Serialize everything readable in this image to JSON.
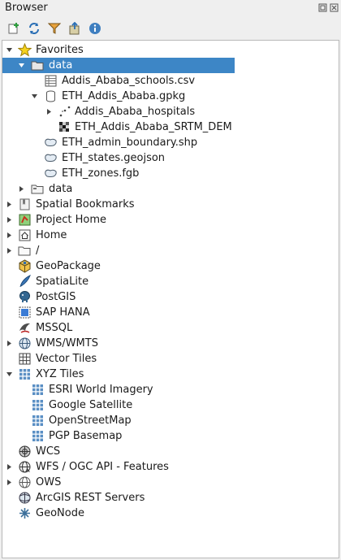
{
  "panel": {
    "title": "Browser"
  },
  "toolbar": [
    {
      "name": "add-layer-button",
      "icon": "add-layer-icon"
    },
    {
      "name": "refresh-button",
      "icon": "refresh-icon"
    },
    {
      "name": "filter-button",
      "icon": "filter-icon"
    },
    {
      "name": "collapse-all-button",
      "icon": "collapse-icon"
    },
    {
      "name": "properties-button",
      "icon": "info-icon"
    }
  ],
  "tree": {
    "favorites": "Favorites",
    "data_fav": "data",
    "schools": "Addis_Ababa_schools.csv",
    "gpkg": "ETH_Addis_Ababa.gpkg",
    "hospitals": "Addis_Ababa_hospitals",
    "dem": "ETH_Addis_Ababa_SRTM_DEM",
    "admin": "ETH_admin_boundary.shp",
    "states": "ETH_states.geojson",
    "zones": "ETH_zones.fgb",
    "data_dir": "data",
    "bookmarks": "Spatial Bookmarks",
    "project_home": "Project Home",
    "home": "Home",
    "root": "/",
    "geopackage": "GeoPackage",
    "spatialite": "SpatiaLite",
    "postgis": "PostGIS",
    "saphana": "SAP HANA",
    "mssql": "MSSQL",
    "wms": "WMS/WMTS",
    "vectortiles": "Vector Tiles",
    "xyz": "XYZ Tiles",
    "esri": "ESRI World Imagery",
    "google": "Google Satellite",
    "osm": "OpenStreetMap",
    "pgp": "PGP Basemap",
    "wcs": "WCS",
    "wfs": "WFS / OGC API - Features",
    "ows": "OWS",
    "arcgis": "ArcGIS REST Servers",
    "geonode": "GeoNode"
  }
}
